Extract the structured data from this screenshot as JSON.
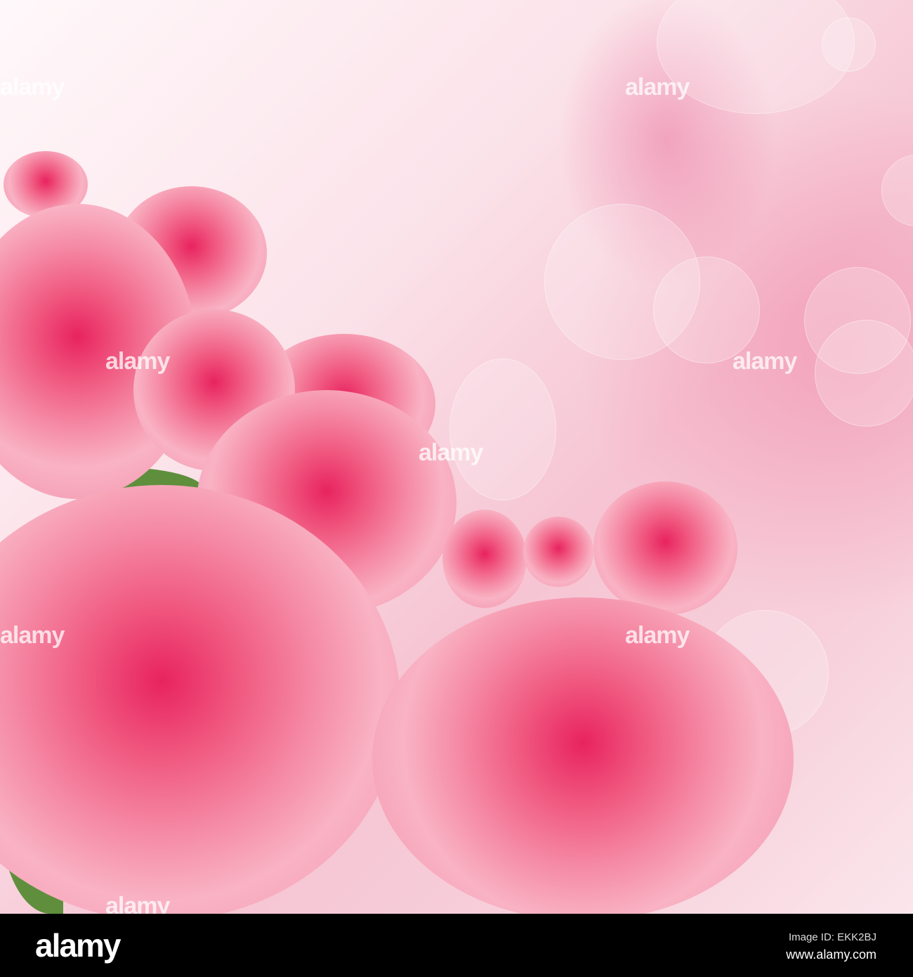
{
  "watermark": "alamy",
  "footer": {
    "logo": "alamy",
    "image_id": "Image ID: EKK2BJ",
    "url": "www.alamy.com"
  }
}
